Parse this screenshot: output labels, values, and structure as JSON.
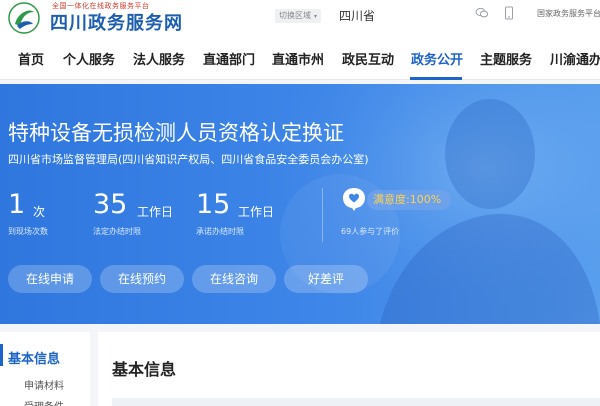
{
  "header": {
    "slogan": "全国一体化在线政务服务平台",
    "site_title": "四川政务服务网",
    "region_switch": "切换区域",
    "region_caret": "▾",
    "province": "四川省",
    "national_link": "国家政务服务平台"
  },
  "nav": {
    "items": [
      "首页",
      "个人服务",
      "法人服务",
      "直通部门",
      "直通市州",
      "政民互动",
      "政务公开",
      "主题服务",
      "川渝通办"
    ],
    "active_index": 6
  },
  "banner": {
    "title": "特种设备无损检测人员资格认定换证",
    "department": "四川省市场监督管理局(四川省知识产权局、四川省食品安全委员会办公室)",
    "stats": [
      {
        "value": "1",
        "unit": "次",
        "label": "到现场次数"
      },
      {
        "value": "35",
        "unit": "工作日",
        "label": "法定办结时限"
      },
      {
        "value": "15",
        "unit": "工作日",
        "label": "承诺办结时限"
      }
    ],
    "satisfaction": "满意度:100%",
    "satisfaction_count": "69人参与了评价",
    "actions": [
      "在线申请",
      "在线预约",
      "在线咨询",
      "好差评"
    ]
  },
  "sidebar": {
    "title": "基本信息",
    "items": [
      "申请材料",
      "受理条件"
    ]
  },
  "content": {
    "title": "基本信息"
  },
  "colors": {
    "brand_blue": "#1d64c8",
    "banner_blue": "#3e86e8",
    "satisfaction_gold": "#ffd34f",
    "slogan_red": "#d03a2c"
  }
}
